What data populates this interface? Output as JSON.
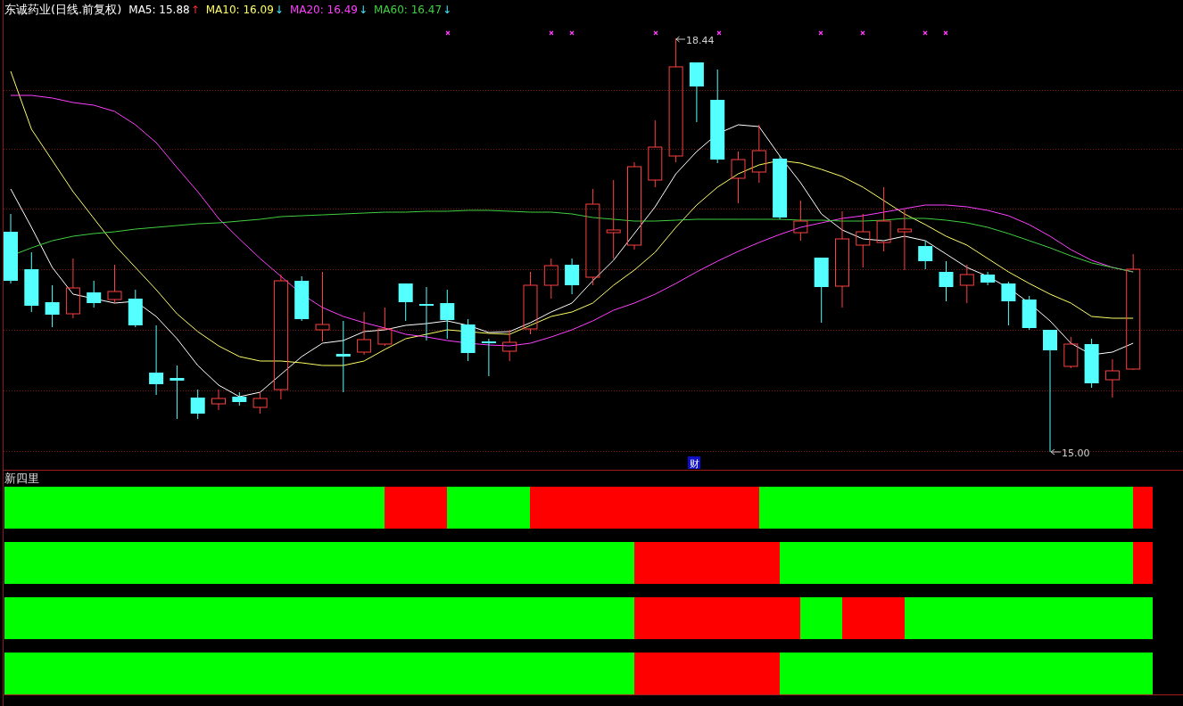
{
  "header": {
    "title": "东诚药业(日线.前复权)",
    "moving_averages": [
      {
        "label": "MA5: 15.88",
        "color": "#ffffff",
        "arrow": "↑",
        "rising": true
      },
      {
        "label": "MA10: 16.09",
        "color": "#ffff66",
        "arrow": "↓",
        "rising": false
      },
      {
        "label": "MA20: 16.49",
        "color": "#ff40ff",
        "arrow": "↓",
        "rising": false
      },
      {
        "label": "MA60: 16.47",
        "color": "#40d040",
        "arrow": "↓",
        "rising": false
      }
    ]
  },
  "price_chart": {
    "high_label": "18.44",
    "low_label": "15.00",
    "event_tag": "财"
  },
  "indicator_panel": {
    "title": "新四里",
    "rows": [
      {
        "days": [
          {
            "color": "#00ff00"
          },
          {
            "color": "#00ff00"
          },
          {
            "color": "#00ff00"
          },
          {
            "color": "#00ff00"
          },
          {
            "color": "#00ff00"
          },
          {
            "color": "#00ff00"
          },
          {
            "color": "#00ff00"
          },
          {
            "color": "#00ff00"
          },
          {
            "color": "#00ff00"
          },
          {
            "color": "#00ff00"
          },
          {
            "color": "#00ff00"
          },
          {
            "color": "#00ff00"
          },
          {
            "color": "#00ff00"
          },
          {
            "color": "#00ff00"
          },
          {
            "color": "#00ff00"
          },
          {
            "color": "#00ff00"
          },
          {
            "color": "#00ff00"
          },
          {
            "color": "#00ff00"
          },
          {
            "color": "#ff0000"
          },
          {
            "color": "#ff0000"
          },
          {
            "color": "#ff0000"
          },
          {
            "color": "#00ff00"
          },
          {
            "color": "#00ff00"
          },
          {
            "color": "#00ff00"
          },
          {
            "color": "#00ff00"
          },
          {
            "color": "#ff0000"
          },
          {
            "color": "#ff0000"
          },
          {
            "color": "#ff0000"
          },
          {
            "color": "#ff0000"
          },
          {
            "color": "#ff0000"
          },
          {
            "color": "#ff0000"
          },
          {
            "color": "#ff0000"
          },
          {
            "color": "#ff0000"
          },
          {
            "color": "#ff0000"
          },
          {
            "color": "#ff0000"
          },
          {
            "color": "#ff0000"
          },
          {
            "color": "#00ff00"
          },
          {
            "color": "#00ff00"
          },
          {
            "color": "#00ff00"
          },
          {
            "color": "#00ff00"
          },
          {
            "color": "#00ff00"
          },
          {
            "color": "#00ff00"
          },
          {
            "color": "#00ff00"
          },
          {
            "color": "#00ff00"
          },
          {
            "color": "#00ff00"
          },
          {
            "color": "#00ff00"
          },
          {
            "color": "#00ff00"
          },
          {
            "color": "#00ff00"
          },
          {
            "color": "#00ff00"
          },
          {
            "color": "#00ff00"
          },
          {
            "color": "#00ff00"
          },
          {
            "color": "#00ff00"
          },
          {
            "color": "#00ff00"
          },
          {
            "color": "#00ff00"
          },
          {
            "color": "#ff0000"
          }
        ]
      },
      {
        "days": [
          {
            "color": "#00ff00"
          },
          {
            "color": "#00ff00"
          },
          {
            "color": "#00ff00"
          },
          {
            "color": "#00ff00"
          },
          {
            "color": "#00ff00"
          },
          {
            "color": "#00ff00"
          },
          {
            "color": "#00ff00"
          },
          {
            "color": "#00ff00"
          },
          {
            "color": "#00ff00"
          },
          {
            "color": "#00ff00"
          },
          {
            "color": "#00ff00"
          },
          {
            "color": "#00ff00"
          },
          {
            "color": "#00ff00"
          },
          {
            "color": "#00ff00"
          },
          {
            "color": "#00ff00"
          },
          {
            "color": "#00ff00"
          },
          {
            "color": "#00ff00"
          },
          {
            "color": "#00ff00"
          },
          {
            "color": "#00ff00"
          },
          {
            "color": "#00ff00"
          },
          {
            "color": "#00ff00"
          },
          {
            "color": "#00ff00"
          },
          {
            "color": "#00ff00"
          },
          {
            "color": "#00ff00"
          },
          {
            "color": "#00ff00"
          },
          {
            "color": "#00ff00"
          },
          {
            "color": "#00ff00"
          },
          {
            "color": "#00ff00"
          },
          {
            "color": "#00ff00"
          },
          {
            "color": "#00ff00"
          },
          {
            "color": "#ff0000"
          },
          {
            "color": "#ff0000"
          },
          {
            "color": "#ff0000"
          },
          {
            "color": "#ff0000"
          },
          {
            "color": "#ff0000"
          },
          {
            "color": "#ff0000"
          },
          {
            "color": "#ff0000"
          },
          {
            "color": "#00ff00"
          },
          {
            "color": "#00ff00"
          },
          {
            "color": "#00ff00"
          },
          {
            "color": "#00ff00"
          },
          {
            "color": "#00ff00"
          },
          {
            "color": "#00ff00"
          },
          {
            "color": "#00ff00"
          },
          {
            "color": "#00ff00"
          },
          {
            "color": "#00ff00"
          },
          {
            "color": "#00ff00"
          },
          {
            "color": "#00ff00"
          },
          {
            "color": "#00ff00"
          },
          {
            "color": "#00ff00"
          },
          {
            "color": "#00ff00"
          },
          {
            "color": "#00ff00"
          },
          {
            "color": "#00ff00"
          },
          {
            "color": "#00ff00"
          },
          {
            "color": "#ff0000"
          }
        ]
      },
      {
        "days": [
          {
            "color": "#00ff00"
          },
          {
            "color": "#00ff00"
          },
          {
            "color": "#00ff00"
          },
          {
            "color": "#00ff00"
          },
          {
            "color": "#00ff00"
          },
          {
            "color": "#00ff00"
          },
          {
            "color": "#00ff00"
          },
          {
            "color": "#00ff00"
          },
          {
            "color": "#00ff00"
          },
          {
            "color": "#00ff00"
          },
          {
            "color": "#00ff00"
          },
          {
            "color": "#00ff00"
          },
          {
            "color": "#00ff00"
          },
          {
            "color": "#00ff00"
          },
          {
            "color": "#00ff00"
          },
          {
            "color": "#00ff00"
          },
          {
            "color": "#00ff00"
          },
          {
            "color": "#00ff00"
          },
          {
            "color": "#00ff00"
          },
          {
            "color": "#00ff00"
          },
          {
            "color": "#00ff00"
          },
          {
            "color": "#00ff00"
          },
          {
            "color": "#00ff00"
          },
          {
            "color": "#00ff00"
          },
          {
            "color": "#00ff00"
          },
          {
            "color": "#00ff00"
          },
          {
            "color": "#00ff00"
          },
          {
            "color": "#00ff00"
          },
          {
            "color": "#00ff00"
          },
          {
            "color": "#00ff00"
          },
          {
            "color": "#ff0000"
          },
          {
            "color": "#ff0000"
          },
          {
            "color": "#ff0000"
          },
          {
            "color": "#ff0000"
          },
          {
            "color": "#ff0000"
          },
          {
            "color": "#ff0000"
          },
          {
            "color": "#ff0000"
          },
          {
            "color": "#ff0000"
          },
          {
            "color": "#00ff00"
          },
          {
            "color": "#00ff00"
          },
          {
            "color": "#ff0000"
          },
          {
            "color": "#ff0000"
          },
          {
            "color": "#ff0000"
          },
          {
            "color": "#00ff00"
          },
          {
            "color": "#00ff00"
          },
          {
            "color": "#00ff00"
          },
          {
            "color": "#00ff00"
          },
          {
            "color": "#00ff00"
          },
          {
            "color": "#00ff00"
          },
          {
            "color": "#00ff00"
          },
          {
            "color": "#00ff00"
          },
          {
            "color": "#00ff00"
          },
          {
            "color": "#00ff00"
          },
          {
            "color": "#00ff00"
          },
          {
            "color": "#00ff00"
          }
        ]
      },
      {
        "days": [
          {
            "color": "#00ff00"
          },
          {
            "color": "#00ff00"
          },
          {
            "color": "#00ff00"
          },
          {
            "color": "#00ff00"
          },
          {
            "color": "#00ff00"
          },
          {
            "color": "#00ff00"
          },
          {
            "color": "#00ff00"
          },
          {
            "color": "#00ff00"
          },
          {
            "color": "#00ff00"
          },
          {
            "color": "#00ff00"
          },
          {
            "color": "#00ff00"
          },
          {
            "color": "#00ff00"
          },
          {
            "color": "#00ff00"
          },
          {
            "color": "#00ff00"
          },
          {
            "color": "#00ff00"
          },
          {
            "color": "#00ff00"
          },
          {
            "color": "#00ff00"
          },
          {
            "color": "#00ff00"
          },
          {
            "color": "#00ff00"
          },
          {
            "color": "#00ff00"
          },
          {
            "color": "#00ff00"
          },
          {
            "color": "#00ff00"
          },
          {
            "color": "#00ff00"
          },
          {
            "color": "#00ff00"
          },
          {
            "color": "#00ff00"
          },
          {
            "color": "#00ff00"
          },
          {
            "color": "#00ff00"
          },
          {
            "color": "#00ff00"
          },
          {
            "color": "#00ff00"
          },
          {
            "color": "#00ff00"
          },
          {
            "color": "#ff0000"
          },
          {
            "color": "#ff0000"
          },
          {
            "color": "#ff0000"
          },
          {
            "color": "#ff0000"
          },
          {
            "color": "#ff0000"
          },
          {
            "color": "#ff0000"
          },
          {
            "color": "#ff0000"
          },
          {
            "color": "#00ff00"
          },
          {
            "color": "#00ff00"
          },
          {
            "color": "#00ff00"
          },
          {
            "color": "#00ff00"
          },
          {
            "color": "#00ff00"
          },
          {
            "color": "#00ff00"
          },
          {
            "color": "#00ff00"
          },
          {
            "color": "#00ff00"
          },
          {
            "color": "#00ff00"
          },
          {
            "color": "#00ff00"
          },
          {
            "color": "#00ff00"
          },
          {
            "color": "#00ff00"
          },
          {
            "color": "#00ff00"
          },
          {
            "color": "#00ff00"
          },
          {
            "color": "#00ff00"
          },
          {
            "color": "#00ff00"
          },
          {
            "color": "#00ff00"
          },
          {
            "color": "#00ff00"
          }
        ]
      }
    ]
  }
}
